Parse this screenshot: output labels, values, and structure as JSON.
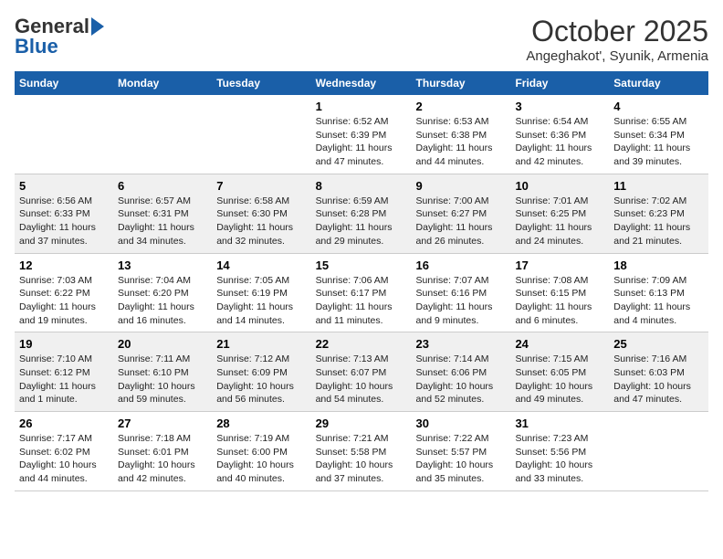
{
  "header": {
    "logo_line1": "General",
    "logo_line2": "Blue",
    "month": "October 2025",
    "location": "Angeghakot', Syunik, Armenia"
  },
  "columns": [
    "Sunday",
    "Monday",
    "Tuesday",
    "Wednesday",
    "Thursday",
    "Friday",
    "Saturday"
  ],
  "weeks": [
    [
      {
        "day": "",
        "info": ""
      },
      {
        "day": "",
        "info": ""
      },
      {
        "day": "",
        "info": ""
      },
      {
        "day": "1",
        "info": "Sunrise: 6:52 AM\nSunset: 6:39 PM\nDaylight: 11 hours and 47 minutes."
      },
      {
        "day": "2",
        "info": "Sunrise: 6:53 AM\nSunset: 6:38 PM\nDaylight: 11 hours and 44 minutes."
      },
      {
        "day": "3",
        "info": "Sunrise: 6:54 AM\nSunset: 6:36 PM\nDaylight: 11 hours and 42 minutes."
      },
      {
        "day": "4",
        "info": "Sunrise: 6:55 AM\nSunset: 6:34 PM\nDaylight: 11 hours and 39 minutes."
      }
    ],
    [
      {
        "day": "5",
        "info": "Sunrise: 6:56 AM\nSunset: 6:33 PM\nDaylight: 11 hours and 37 minutes."
      },
      {
        "day": "6",
        "info": "Sunrise: 6:57 AM\nSunset: 6:31 PM\nDaylight: 11 hours and 34 minutes."
      },
      {
        "day": "7",
        "info": "Sunrise: 6:58 AM\nSunset: 6:30 PM\nDaylight: 11 hours and 32 minutes."
      },
      {
        "day": "8",
        "info": "Sunrise: 6:59 AM\nSunset: 6:28 PM\nDaylight: 11 hours and 29 minutes."
      },
      {
        "day": "9",
        "info": "Sunrise: 7:00 AM\nSunset: 6:27 PM\nDaylight: 11 hours and 26 minutes."
      },
      {
        "day": "10",
        "info": "Sunrise: 7:01 AM\nSunset: 6:25 PM\nDaylight: 11 hours and 24 minutes."
      },
      {
        "day": "11",
        "info": "Sunrise: 7:02 AM\nSunset: 6:23 PM\nDaylight: 11 hours and 21 minutes."
      }
    ],
    [
      {
        "day": "12",
        "info": "Sunrise: 7:03 AM\nSunset: 6:22 PM\nDaylight: 11 hours and 19 minutes."
      },
      {
        "day": "13",
        "info": "Sunrise: 7:04 AM\nSunset: 6:20 PM\nDaylight: 11 hours and 16 minutes."
      },
      {
        "day": "14",
        "info": "Sunrise: 7:05 AM\nSunset: 6:19 PM\nDaylight: 11 hours and 14 minutes."
      },
      {
        "day": "15",
        "info": "Sunrise: 7:06 AM\nSunset: 6:17 PM\nDaylight: 11 hours and 11 minutes."
      },
      {
        "day": "16",
        "info": "Sunrise: 7:07 AM\nSunset: 6:16 PM\nDaylight: 11 hours and 9 minutes."
      },
      {
        "day": "17",
        "info": "Sunrise: 7:08 AM\nSunset: 6:15 PM\nDaylight: 11 hours and 6 minutes."
      },
      {
        "day": "18",
        "info": "Sunrise: 7:09 AM\nSunset: 6:13 PM\nDaylight: 11 hours and 4 minutes."
      }
    ],
    [
      {
        "day": "19",
        "info": "Sunrise: 7:10 AM\nSunset: 6:12 PM\nDaylight: 11 hours and 1 minute."
      },
      {
        "day": "20",
        "info": "Sunrise: 7:11 AM\nSunset: 6:10 PM\nDaylight: 10 hours and 59 minutes."
      },
      {
        "day": "21",
        "info": "Sunrise: 7:12 AM\nSunset: 6:09 PM\nDaylight: 10 hours and 56 minutes."
      },
      {
        "day": "22",
        "info": "Sunrise: 7:13 AM\nSunset: 6:07 PM\nDaylight: 10 hours and 54 minutes."
      },
      {
        "day": "23",
        "info": "Sunrise: 7:14 AM\nSunset: 6:06 PM\nDaylight: 10 hours and 52 minutes."
      },
      {
        "day": "24",
        "info": "Sunrise: 7:15 AM\nSunset: 6:05 PM\nDaylight: 10 hours and 49 minutes."
      },
      {
        "day": "25",
        "info": "Sunrise: 7:16 AM\nSunset: 6:03 PM\nDaylight: 10 hours and 47 minutes."
      }
    ],
    [
      {
        "day": "26",
        "info": "Sunrise: 7:17 AM\nSunset: 6:02 PM\nDaylight: 10 hours and 44 minutes."
      },
      {
        "day": "27",
        "info": "Sunrise: 7:18 AM\nSunset: 6:01 PM\nDaylight: 10 hours and 42 minutes."
      },
      {
        "day": "28",
        "info": "Sunrise: 7:19 AM\nSunset: 6:00 PM\nDaylight: 10 hours and 40 minutes."
      },
      {
        "day": "29",
        "info": "Sunrise: 7:21 AM\nSunset: 5:58 PM\nDaylight: 10 hours and 37 minutes."
      },
      {
        "day": "30",
        "info": "Sunrise: 7:22 AM\nSunset: 5:57 PM\nDaylight: 10 hours and 35 minutes."
      },
      {
        "day": "31",
        "info": "Sunrise: 7:23 AM\nSunset: 5:56 PM\nDaylight: 10 hours and 33 minutes."
      },
      {
        "day": "",
        "info": ""
      }
    ]
  ]
}
